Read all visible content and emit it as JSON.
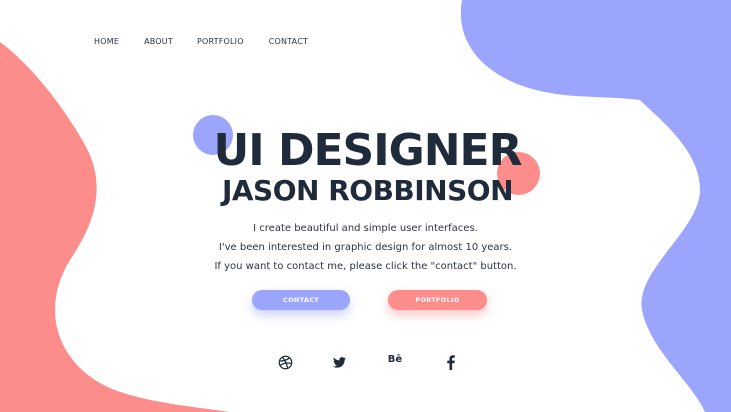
{
  "nav": {
    "items": [
      {
        "label": "HOME"
      },
      {
        "label": "ABOUT"
      },
      {
        "label": "PORTFOLIO"
      },
      {
        "label": "CONTACT"
      }
    ]
  },
  "hero": {
    "title": "UI DESIGNER",
    "name": "JASON ROBBINSON",
    "description": [
      "I create beautiful and simple user interfaces.",
      "I've been interested in graphic design for almost 10 years.",
      "If you want to contact me, please click the \"contact\" button."
    ]
  },
  "buttons": {
    "contact_label": "CONTACT",
    "portfolio_label": "PORTFOLIO"
  },
  "social": {
    "behance_label": "Bē",
    "icons": [
      "dribbble-icon",
      "twitter-icon",
      "behance-icon",
      "facebook-icon"
    ]
  },
  "colors": {
    "accent_blue": "#9aa5fb",
    "accent_pink": "#fd8d8b",
    "text_dark": "#1f2b3b",
    "background": "#ffffff"
  }
}
